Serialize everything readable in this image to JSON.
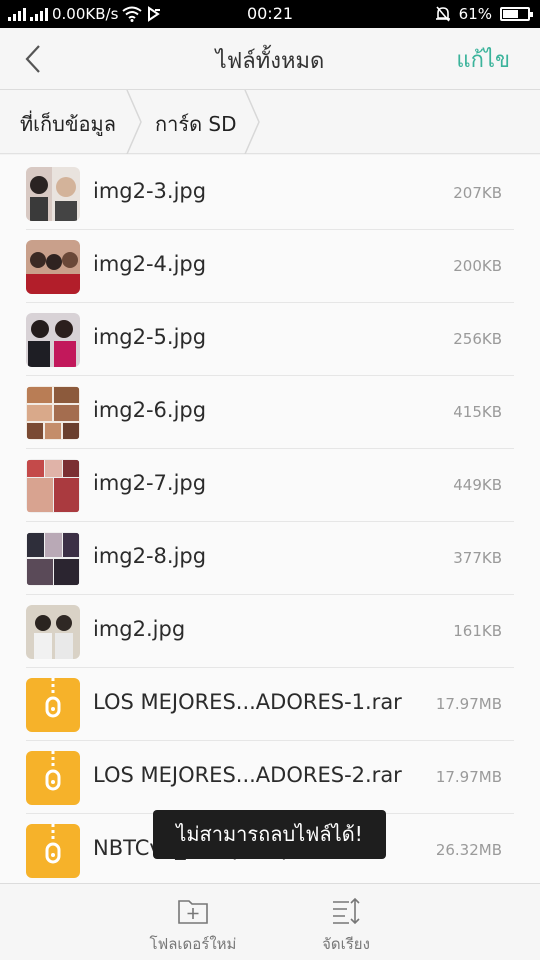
{
  "status_bar": {
    "net_speed": "0.00KB/s",
    "time": "00:21",
    "battery": "61%",
    "battery_level": 0.61,
    "icons": [
      "signal-bars-icon",
      "signal-bars-icon",
      "wifi-icon",
      "data-sync-icon",
      "silent-bell-icon",
      "battery-icon"
    ]
  },
  "header": {
    "title": "ไฟล์ทั้งหมด",
    "edit_label": "แก้ไข",
    "accent": "#3bb39b"
  },
  "breadcrumb": {
    "items": [
      "ที่เก็บข้อมูล",
      "การ์ด SD"
    ]
  },
  "files": [
    {
      "name": "img2-3.jpg",
      "size": "207KB",
      "type": "image"
    },
    {
      "name": "img2-4.jpg",
      "size": "200KB",
      "type": "image"
    },
    {
      "name": "img2-5.jpg",
      "size": "256KB",
      "type": "image"
    },
    {
      "name": "img2-6.jpg",
      "size": "415KB",
      "type": "image"
    },
    {
      "name": "img2-7.jpg",
      "size": "449KB",
      "type": "image"
    },
    {
      "name": "img2-8.jpg",
      "size": "377KB",
      "type": "image"
    },
    {
      "name": "img2.jpg",
      "size": "161KB",
      "type": "image"
    },
    {
      "name": "LOS MEJORES...ADORES-1.rar",
      "size": "17.97MB",
      "type": "archive"
    },
    {
      "name": "LOS MEJORES...ADORES-2.rar",
      "size": "17.97MB",
      "type": "archive"
    },
    {
      "name": "NBTCv2_99.apk.zip",
      "size": "26.32MB",
      "type": "archive"
    }
  ],
  "toast": {
    "message": "ไม่สามารถลบไฟล์ได้!"
  },
  "bottom_bar": {
    "new_folder_label": "โฟลเดอร์ใหม่",
    "sort_label": "จัดเรียง"
  },
  "colors": {
    "archive_icon": "#f6b22a"
  }
}
